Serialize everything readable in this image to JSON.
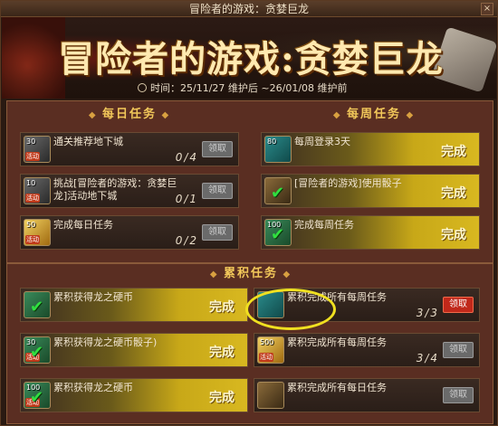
{
  "window": {
    "title": "冒险者的游戏：贪婪巨龙",
    "close_label": "×"
  },
  "banner": {
    "title": "冒险者的游戏:贪婪巨龙",
    "time_text": "时间：25/11/27 维护后 ~26/01/08 维护前"
  },
  "sections": {
    "daily": "每日任务",
    "weekly": "每周任务",
    "cumulative": "累积任务"
  },
  "daily_tasks": [
    {
      "icon_num": "30",
      "icon_tag": "活动",
      "text": "通关推荐地下城",
      "progress": "0/4",
      "button": "领取",
      "state": "locked"
    },
    {
      "icon_num": "10",
      "icon_tag": "活动",
      "text": "挑战[冒险者的游戏：贪婪巨龙]活动地下城",
      "progress": "0/1",
      "button": "领取",
      "state": "locked"
    },
    {
      "icon_num": "50",
      "icon_tag": "活动",
      "text": "完成每日任务",
      "progress": "0/2",
      "button": "领取",
      "state": "locked"
    }
  ],
  "weekly_tasks": [
    {
      "icon_num": "80",
      "text": "每周登录3天",
      "status": "完成"
    },
    {
      "icon_num": "",
      "text": "[冒险者的游戏]使用骰子",
      "status": "完成"
    },
    {
      "icon_num": "100",
      "text": "完成每周任务",
      "status": "完成"
    }
  ],
  "cumulative_left": [
    {
      "icon_num": "",
      "icon_tag": "",
      "text": "累积获得龙之硬币",
      "status": "完成"
    },
    {
      "icon_num": "30",
      "icon_tag": "活动",
      "text": "累积获得龙之硬币骰子)",
      "status": "完成"
    },
    {
      "icon_num": "100",
      "icon_tag": "活动",
      "text": "累积获得龙之硬币",
      "status": "完成"
    }
  ],
  "cumulative_right": [
    {
      "icon_num": "",
      "text": "累积完成所有每周任务",
      "progress": "3/3",
      "button": "领取",
      "state": "active"
    },
    {
      "icon_num": "500",
      "icon_tag": "活动",
      "text": "累积完成所有每周任务",
      "progress": "3/4",
      "button": "领取",
      "state": "locked"
    },
    {
      "icon_num": "",
      "text": "累积完成所有每日任务",
      "progress": "",
      "button": "领取",
      "state": "locked"
    }
  ]
}
